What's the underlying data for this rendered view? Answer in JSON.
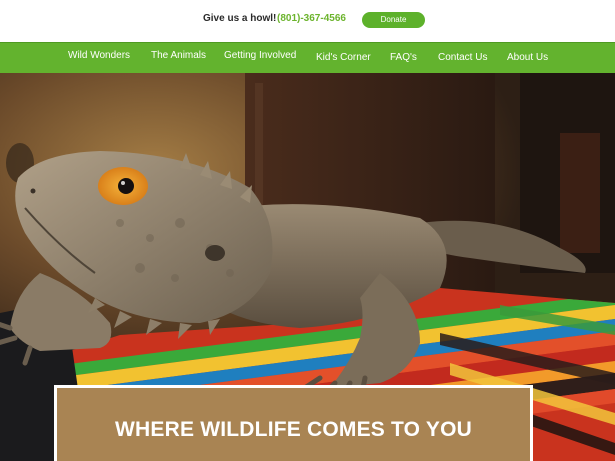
{
  "topbar": {
    "tagline": "Give us a howl!",
    "phone": "(801)-367-4566",
    "donate_label": "Donate"
  },
  "nav": {
    "items": [
      {
        "label": "Wild Wonders"
      },
      {
        "label": "The Animals"
      },
      {
        "label": "Getting Involved"
      },
      {
        "label": "Kid's Corner"
      },
      {
        "label": "FAQ's"
      },
      {
        "label": "Contact Us"
      },
      {
        "label": "About Us"
      }
    ]
  },
  "hero": {
    "banner_title": "WHERE WILDLIFE COMES TO YOU"
  },
  "colors": {
    "accent_green": "#63b32e",
    "phone_green": "#6cb42d",
    "banner_tan": "#a98453"
  }
}
